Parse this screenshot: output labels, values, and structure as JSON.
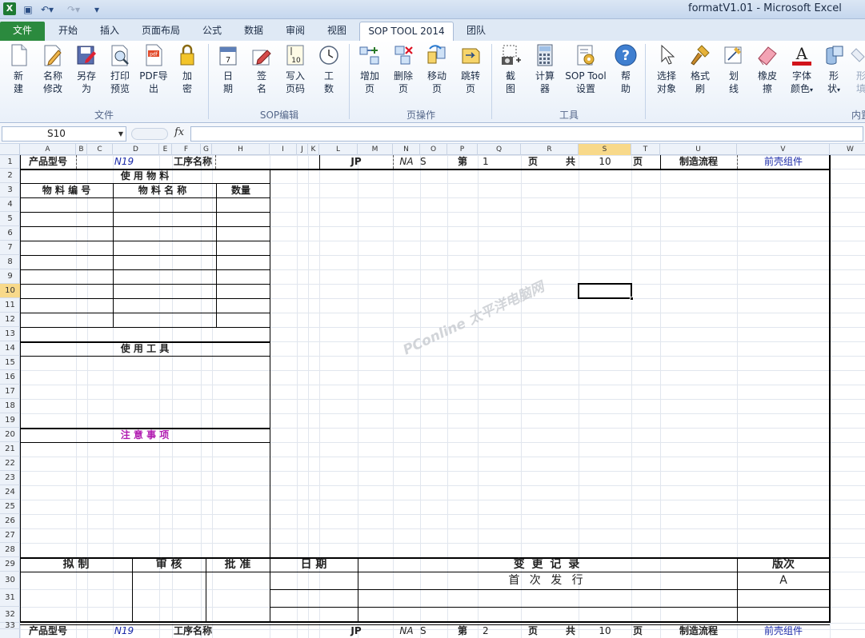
{
  "window": {
    "title": "formatV1.01  -  Microsoft Excel",
    "app_icon": "excel-icon"
  },
  "tabs": [
    {
      "label": "文件",
      "active": false
    },
    {
      "label": "开始",
      "active": false
    },
    {
      "label": "插入",
      "active": false
    },
    {
      "label": "页面布局",
      "active": false
    },
    {
      "label": "公式",
      "active": false
    },
    {
      "label": "数据",
      "active": false
    },
    {
      "label": "审阅",
      "active": false
    },
    {
      "label": "视图",
      "active": false
    },
    {
      "label": "SOP TOOL 2014",
      "active": true
    },
    {
      "label": "团队",
      "active": false
    }
  ],
  "ribbon": {
    "groups": [
      {
        "label": "文件",
        "buttons": [
          {
            "label1": "新",
            "label2": "建",
            "icon": "new-document-icon"
          },
          {
            "label1": "名称",
            "label2": "修改",
            "icon": "rename-icon"
          },
          {
            "label1": "另存",
            "label2": "为",
            "icon": "save-as-icon"
          },
          {
            "label1": "打印",
            "label2": "预览",
            "icon": "print-preview-icon"
          },
          {
            "label1": "PDF导",
            "label2": "出",
            "icon": "pdf-export-icon"
          },
          {
            "label1": "加",
            "label2": "密",
            "icon": "lock-icon"
          }
        ]
      },
      {
        "label": "SOP编辑",
        "buttons": [
          {
            "label1": "日",
            "label2": "期",
            "icon": "calendar-icon"
          },
          {
            "label1": "签",
            "label2": "名",
            "icon": "signature-icon"
          },
          {
            "label1": "写入",
            "label2": "页码",
            "icon": "page-number-icon"
          },
          {
            "label1": "工",
            "label2": "数",
            "icon": "clock-icon"
          }
        ]
      },
      {
        "label": "页操作",
        "buttons": [
          {
            "label1": "增加",
            "label2": "页",
            "icon": "add-page-icon"
          },
          {
            "label1": "删除",
            "label2": "页",
            "icon": "delete-page-icon"
          },
          {
            "label1": "移动",
            "label2": "页",
            "icon": "move-page-icon"
          },
          {
            "label1": "跳转",
            "label2": "页",
            "icon": "goto-page-icon"
          }
        ]
      },
      {
        "label": "工具",
        "buttons": [
          {
            "label1": "截",
            "label2": "图",
            "icon": "screenshot-icon"
          },
          {
            "label1": "计算",
            "label2": "器",
            "icon": "calculator-icon"
          },
          {
            "label1": "SOP Tool",
            "label2": "设置",
            "icon": "settings-icon"
          },
          {
            "label1": "帮",
            "label2": "助",
            "icon": "help-icon"
          }
        ]
      },
      {
        "label": "内置",
        "buttons": [
          {
            "label1": "选择",
            "label2": "对象",
            "icon": "pointer-icon"
          },
          {
            "label1": "格式",
            "label2": "刷",
            "icon": "format-painter-icon"
          },
          {
            "label1": "划",
            "label2": "线",
            "icon": "draw-line-icon"
          },
          {
            "label1": "橡皮",
            "label2": "擦",
            "icon": "eraser-icon"
          },
          {
            "label1": "字体",
            "label2": "颜色",
            "icon": "font-color-icon"
          },
          {
            "label1": "形",
            "label2": "状",
            "icon": "shapes-icon"
          },
          {
            "label1": "形",
            "label2": "填",
            "icon": "shape-fill-icon"
          }
        ]
      }
    ]
  },
  "formula_bar": {
    "name_box": "S10",
    "fx_label": "fx",
    "formula": ""
  },
  "sheet": {
    "columns": [
      "A",
      "B",
      "C",
      "D",
      "E",
      "F",
      "G",
      "H",
      "I",
      "J",
      "K",
      "L",
      "M",
      "N",
      "O",
      "P",
      "Q",
      "R",
      "S",
      "T",
      "U",
      "V",
      "W"
    ],
    "rows": [
      "1",
      "2",
      "3",
      "4",
      "5",
      "6",
      "7",
      "8",
      "9",
      "10",
      "11",
      "12",
      "13",
      "14",
      "15",
      "16",
      "17",
      "18",
      "19",
      "20",
      "21",
      "22",
      "23",
      "24",
      "25",
      "26",
      "27",
      "28",
      "29",
      "30",
      "31",
      "32",
      "33"
    ],
    "selected_cell": "S10",
    "header_row": {
      "product_model_label": "产品型号",
      "product_model_value": "N19",
      "process_name_label": "工序名称",
      "jp": "JP",
      "na": "NA",
      "s": "S",
      "page_di": "第",
      "page_num": "1",
      "page_ye": "页",
      "page_gong": "共",
      "page_total": "10",
      "page_ye2": "页",
      "flow_label": "制造流程",
      "flow_value": "前壳组件"
    },
    "materials": {
      "title": "使 用 物 料",
      "col_code": "物 料 编 号",
      "col_name": "物 料 名 称",
      "col_qty": "数量"
    },
    "tools_title": "使 用 工 具",
    "notes_title": "注 意 事 项",
    "footer": {
      "draft": "拟 制",
      "review": "审 核",
      "approve": "批 准",
      "date": "日 期",
      "change_record": "变 更 记 录",
      "version_label": "版次",
      "first_release": "首 次 发 行",
      "version_value": "A"
    },
    "next_page_header": {
      "product_model_label": "产品型号",
      "product_model_value": "N19",
      "process_name_label": "工序名称",
      "jp": "JP",
      "na": "NA",
      "s": "S",
      "page_di": "第",
      "page_num": "2",
      "page_ye": "页",
      "page_gong": "共",
      "page_total": "10",
      "page_ye2": "页",
      "flow_label": "制造流程",
      "flow_value": "前壳组件"
    },
    "watermark": "PConline 太平洋电脑网"
  }
}
